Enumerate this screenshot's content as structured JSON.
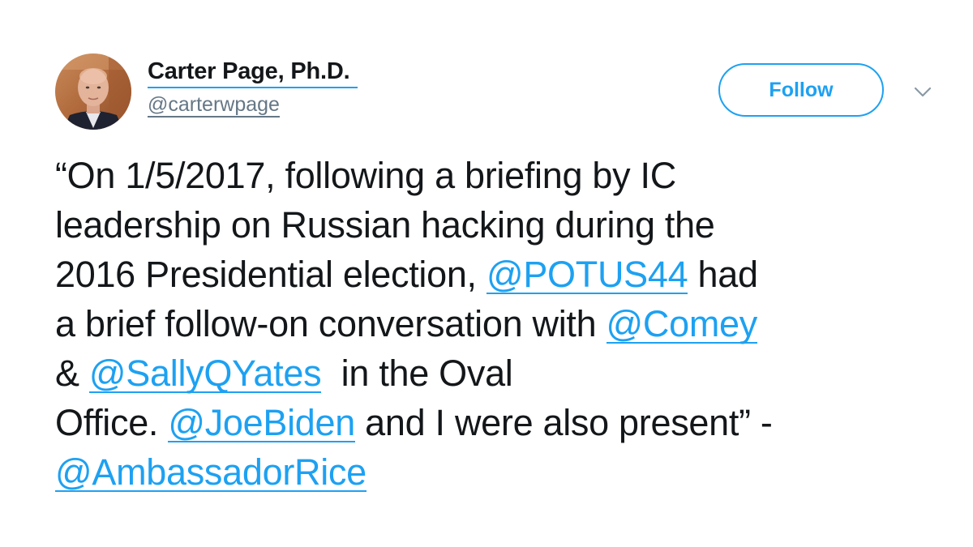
{
  "user": {
    "display_name": "Carter Page, Ph.D.",
    "handle": "@carterwpage",
    "avatar_icon": "profile-photo"
  },
  "actions": {
    "follow_label": "Follow",
    "menu_icon": "chevron-down-icon"
  },
  "colors": {
    "accent": "#1da1f2",
    "text": "#14171a",
    "secondary": "#657786"
  },
  "tweet": {
    "line1": "“On 1/5/2017, following a briefing by IC",
    "line2": "leadership on Russian hacking during the",
    "line3_pre": "2016 Presidential election, ",
    "mention_potus": "@POTUS44",
    "line3_post": " had",
    "line4_pre": "a brief follow-on conversation with ",
    "mention_comey": "@Comey",
    "line5_pre": "& ",
    "mention_yates": "@SallyQYates",
    "line5_post": "  in the Oval",
    "line6_pre": "Office. ",
    "mention_biden": "@JoeBiden",
    "line6_post": " and I were also present” -",
    "mention_rice": "@AmbassadorRice"
  }
}
